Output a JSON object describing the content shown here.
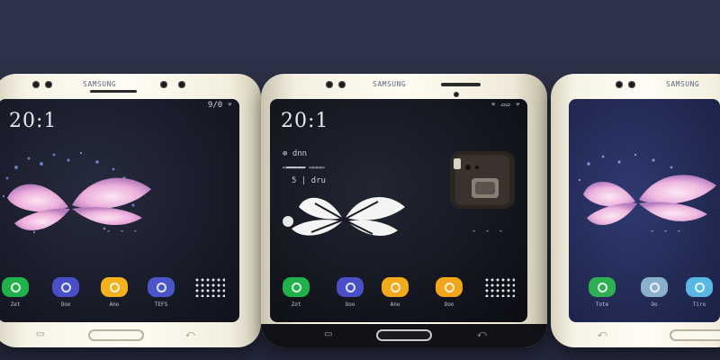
{
  "phones": [
    {
      "brand": "SAMSUNG",
      "clock": "20:1",
      "status": "9/0 ⌔",
      "apps": [
        {
          "label": "Zet",
          "color": "#21b14a"
        },
        {
          "label": "Ooo",
          "color": "#4a4fc7"
        },
        {
          "label": "Ano",
          "color": "#f2b21c"
        },
        {
          "label": "TEFS",
          "color": "#4a55c9"
        }
      ],
      "home_keys": [
        "▭",
        "⤺"
      ],
      "page_dots": "- - -"
    },
    {
      "brand": "SAMSUNG",
      "clock": "20:1",
      "status": "⌔ ▱▱ ⌔",
      "sub_lines": [
        "⊕ dnn",
        "▭▬▬▬▬▬ ▭▭▭▭",
        "5 | dru"
      ],
      "apps": [
        {
          "label": "Zot",
          "color": "#21b14a"
        },
        {
          "label": "Ooo",
          "color": "#4a4fc7"
        },
        {
          "label": "Ano",
          "color": "#f2a91c"
        },
        {
          "label": "Ooo",
          "color": "#f0a51a"
        }
      ],
      "home_keys": [
        "▭",
        "⤺"
      ],
      "page_dots": "- - -"
    },
    {
      "brand": "SAMSUNG",
      "apps": [
        {
          "label": "Tote",
          "color": "#2eaf52"
        },
        {
          "label": "Oo",
          "color": "#8ab0cc"
        },
        {
          "label": "Tiro",
          "color": "#58b7e3"
        }
      ],
      "home_keys": [
        "⤺"
      ]
    }
  ],
  "colors": {
    "background": "#2c3046",
    "phone_body": "#fbf8ee",
    "flower": "#f1b8df"
  }
}
